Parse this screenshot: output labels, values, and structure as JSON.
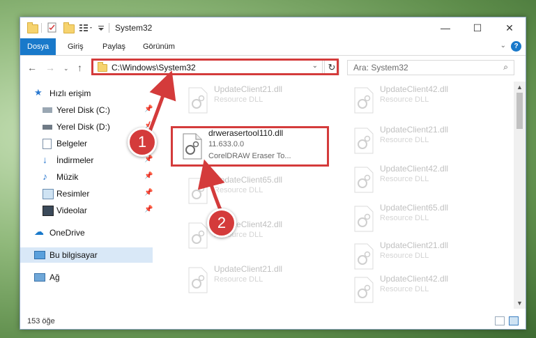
{
  "window": {
    "title": "System32",
    "controls": {
      "minimize": "—",
      "maximize": "☐",
      "close": "✕"
    }
  },
  "ribbon": {
    "tabs": [
      {
        "label": "Dosya",
        "active": true
      },
      {
        "label": "Giriş",
        "active": false
      },
      {
        "label": "Paylaş",
        "active": false
      },
      {
        "label": "Görünüm",
        "active": false
      }
    ],
    "help": "?"
  },
  "nav": {
    "address": "C:\\Windows\\System32",
    "search_placeholder": "Ara: System32"
  },
  "sidebar": {
    "items": [
      {
        "label": "Hızlı erişim",
        "icon": "star-icon",
        "pinned": false
      },
      {
        "label": "Yerel Disk (C:)",
        "icon": "drive-c-icon",
        "pinned": true
      },
      {
        "label": "Yerel Disk (D:)",
        "icon": "drive-d-icon",
        "pinned": true
      },
      {
        "label": "Belgeler",
        "icon": "documents-icon",
        "pinned": true
      },
      {
        "label": "İndirmeler",
        "icon": "downloads-icon",
        "pinned": true
      },
      {
        "label": "Müzik",
        "icon": "music-icon",
        "pinned": true
      },
      {
        "label": "Resimler",
        "icon": "pictures-icon",
        "pinned": true
      },
      {
        "label": "Videolar",
        "icon": "videos-icon",
        "pinned": true
      },
      {
        "label": "OneDrive",
        "icon": "onedrive-icon",
        "pinned": false
      },
      {
        "label": "Bu bilgisayar",
        "icon": "computer-icon",
        "pinned": false
      },
      {
        "label": "Ağ",
        "icon": "network-icon",
        "pinned": false
      }
    ]
  },
  "files": {
    "column_left": [
      {
        "name": "UpdateClient21.dll",
        "desc": "Resource DLL"
      },
      {
        "name": "UpdateClient65.dll",
        "desc": "Resource DLL"
      },
      {
        "name": "UpdateClient42.dll",
        "desc": "Resource DLL"
      },
      {
        "name": "UpdateClient21.dll",
        "desc": "Resource DLL"
      }
    ],
    "column_right": [
      {
        "name": "UpdateClient42.dll",
        "desc": "Resource DLL"
      },
      {
        "name": "UpdateClient21.dll",
        "desc": "Resource DLL"
      },
      {
        "name": "UpdateClient42.dll",
        "desc": "Resource DLL"
      },
      {
        "name": "UpdateClient65.dll",
        "desc": "Resource DLL"
      },
      {
        "name": "UpdateClient21.dll",
        "desc": "Resource DLL"
      },
      {
        "name": "UpdateClient42.dll",
        "desc": "Resource DLL"
      }
    ],
    "highlighted": {
      "name": "drwerasertool110.dll",
      "version": "11.633.0.0",
      "desc": "CorelDRAW Eraser To..."
    }
  },
  "status": {
    "count": "153 öğe"
  },
  "callouts": {
    "one": "1",
    "two": "2"
  },
  "colors": {
    "accent": "#1979ca",
    "highlight": "#d43b3b"
  }
}
